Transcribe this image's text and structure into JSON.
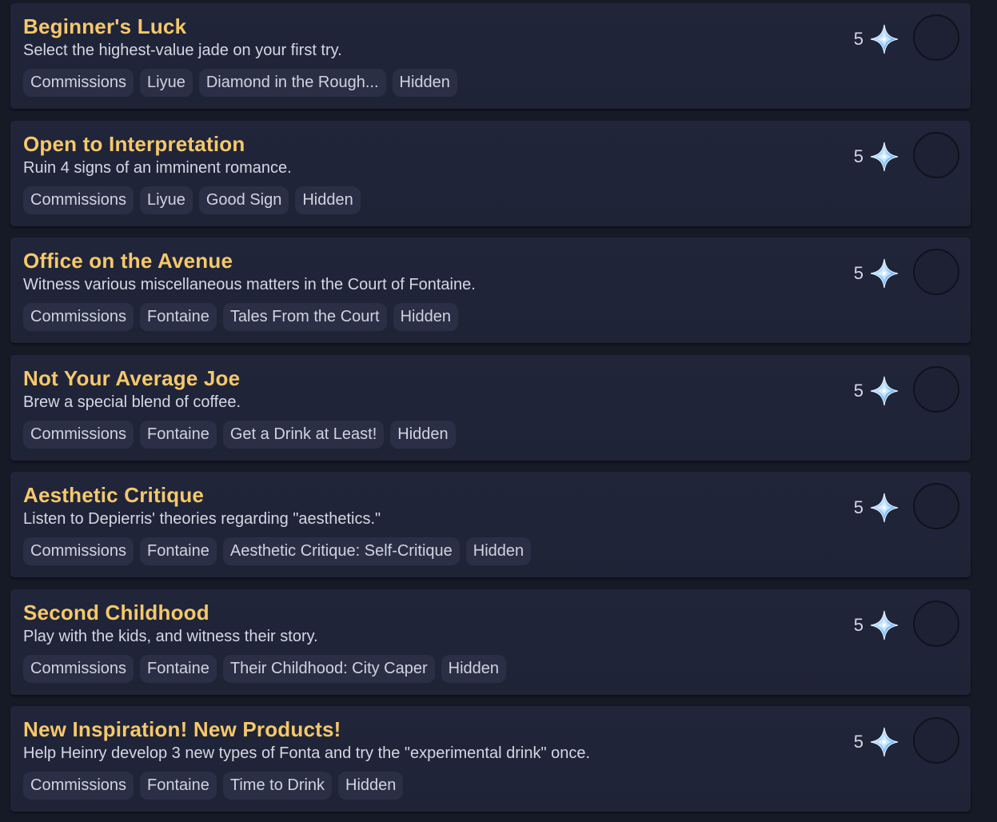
{
  "achievements": [
    {
      "title": "Beginner's Luck",
      "description": "Select the highest-value jade on your first try.",
      "tags": [
        "Commissions",
        "Liyue",
        "Diamond in the Rough...",
        "Hidden"
      ],
      "reward": "5"
    },
    {
      "title": "Open to Interpretation",
      "description": "Ruin 4 signs of an imminent romance.",
      "tags": [
        "Commissions",
        "Liyue",
        "Good Sign",
        "Hidden"
      ],
      "reward": "5"
    },
    {
      "title": "Office on the Avenue",
      "description": "Witness various miscellaneous matters in the Court of Fontaine.",
      "tags": [
        "Commissions",
        "Fontaine",
        "Tales From the Court",
        "Hidden"
      ],
      "reward": "5"
    },
    {
      "title": "Not Your Average Joe",
      "description": "Brew a special blend of coffee.",
      "tags": [
        "Commissions",
        "Fontaine",
        "Get a Drink at Least!",
        "Hidden"
      ],
      "reward": "5"
    },
    {
      "title": "Aesthetic Critique",
      "description": "Listen to Depierris' theories regarding \"aesthetics.\"",
      "tags": [
        "Commissions",
        "Fontaine",
        "Aesthetic Critique: Self-Critique",
        "Hidden"
      ],
      "reward": "5"
    },
    {
      "title": "Second Childhood",
      "description": "Play with the kids, and witness their story.",
      "tags": [
        "Commissions",
        "Fontaine",
        "Their Childhood: City Caper",
        "Hidden"
      ],
      "reward": "5"
    },
    {
      "title": "New Inspiration! New Products!",
      "description": "Help Heinry develop 3 new types of Fonta and try the \"experimental drink\" once.",
      "tags": [
        "Commissions",
        "Fontaine",
        "Time to Drink",
        "Hidden"
      ],
      "reward": "5"
    }
  ],
  "reward_icon": "primogem-icon",
  "completed": [
    false,
    false,
    false,
    false,
    false,
    false,
    false
  ],
  "colors": {
    "background": "#161a26",
    "card": "#20243a",
    "title": "#f5c86a",
    "text": "#d4d7e3",
    "tag": "#2b2f46"
  }
}
